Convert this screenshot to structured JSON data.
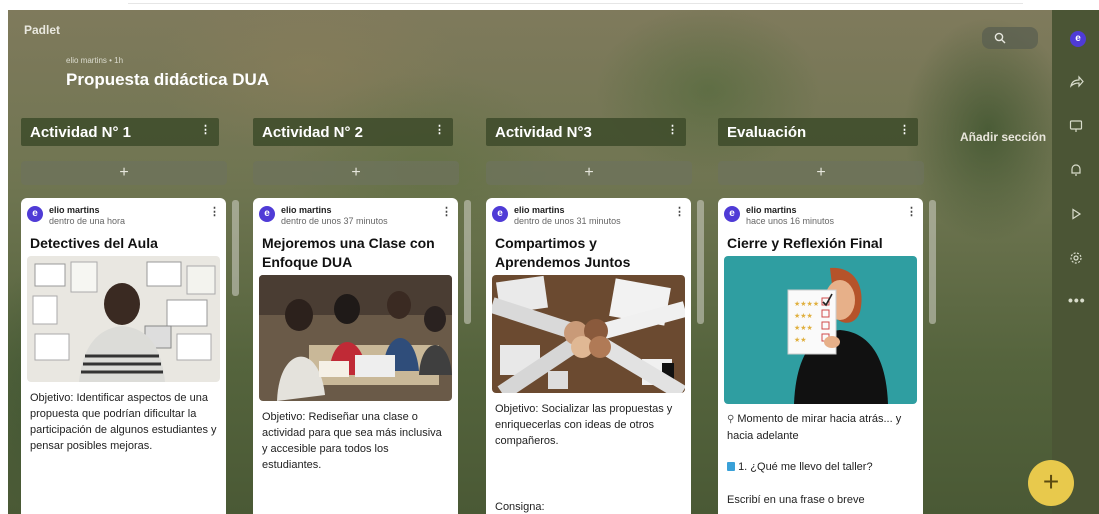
{
  "app": {
    "brand": "Padlet"
  },
  "board": {
    "author_line": "elio martins • 1h",
    "title": "Propuesta didáctica DUA",
    "add_section": "Añadir sección",
    "add_symbol": "+"
  },
  "columns": [
    {
      "title": "Actividad N° 1",
      "card": {
        "author": "elio martins",
        "time": "dentro de una hora",
        "title": "Detectives del Aula",
        "body": "Objetivo: Identificar aspectos de una propuesta que podrían dificultar la participación de algunos estudiantes y pensar posibles mejoras."
      }
    },
    {
      "title": "Actividad N° 2",
      "card": {
        "author": "elio martins",
        "time": "dentro de unos 37 minutos",
        "title": "Mejoremos una Clase con Enfoque DUA",
        "body": "Objetivo: Rediseñar una clase o actividad para que sea más inclusiva y accesible para todos los estudiantes."
      }
    },
    {
      "title": "Actividad N°3",
      "card": {
        "author": "elio martins",
        "time": "dentro de unos 31 minutos",
        "title": "Compartimos y Aprendemos Juntos",
        "body": "Objetivo: Socializar las propuestas y enriquecerlas con ideas de otros compañeros.",
        "extra": "Consigna:"
      }
    },
    {
      "title": "Evaluación",
      "card": {
        "author": "elio martins",
        "time": "hace unos 16 minutos",
        "title": "Cierre y Reflexión Final",
        "body": "Momento de mirar hacia atrás... y hacia adelante",
        "item": "1. ¿Qué me llevo del taller?",
        "extra": "Escribí en una frase o breve"
      }
    }
  ],
  "user": {
    "initial": "e"
  },
  "colors": {
    "accent": "#4f3bd6",
    "fab": "#e8c94c",
    "rail": "#4b5535"
  },
  "icons": [
    "search-icon",
    "share-icon",
    "slideshow-icon",
    "bell-icon",
    "play-icon",
    "gear-icon",
    "more-icon",
    "plus-icon"
  ]
}
